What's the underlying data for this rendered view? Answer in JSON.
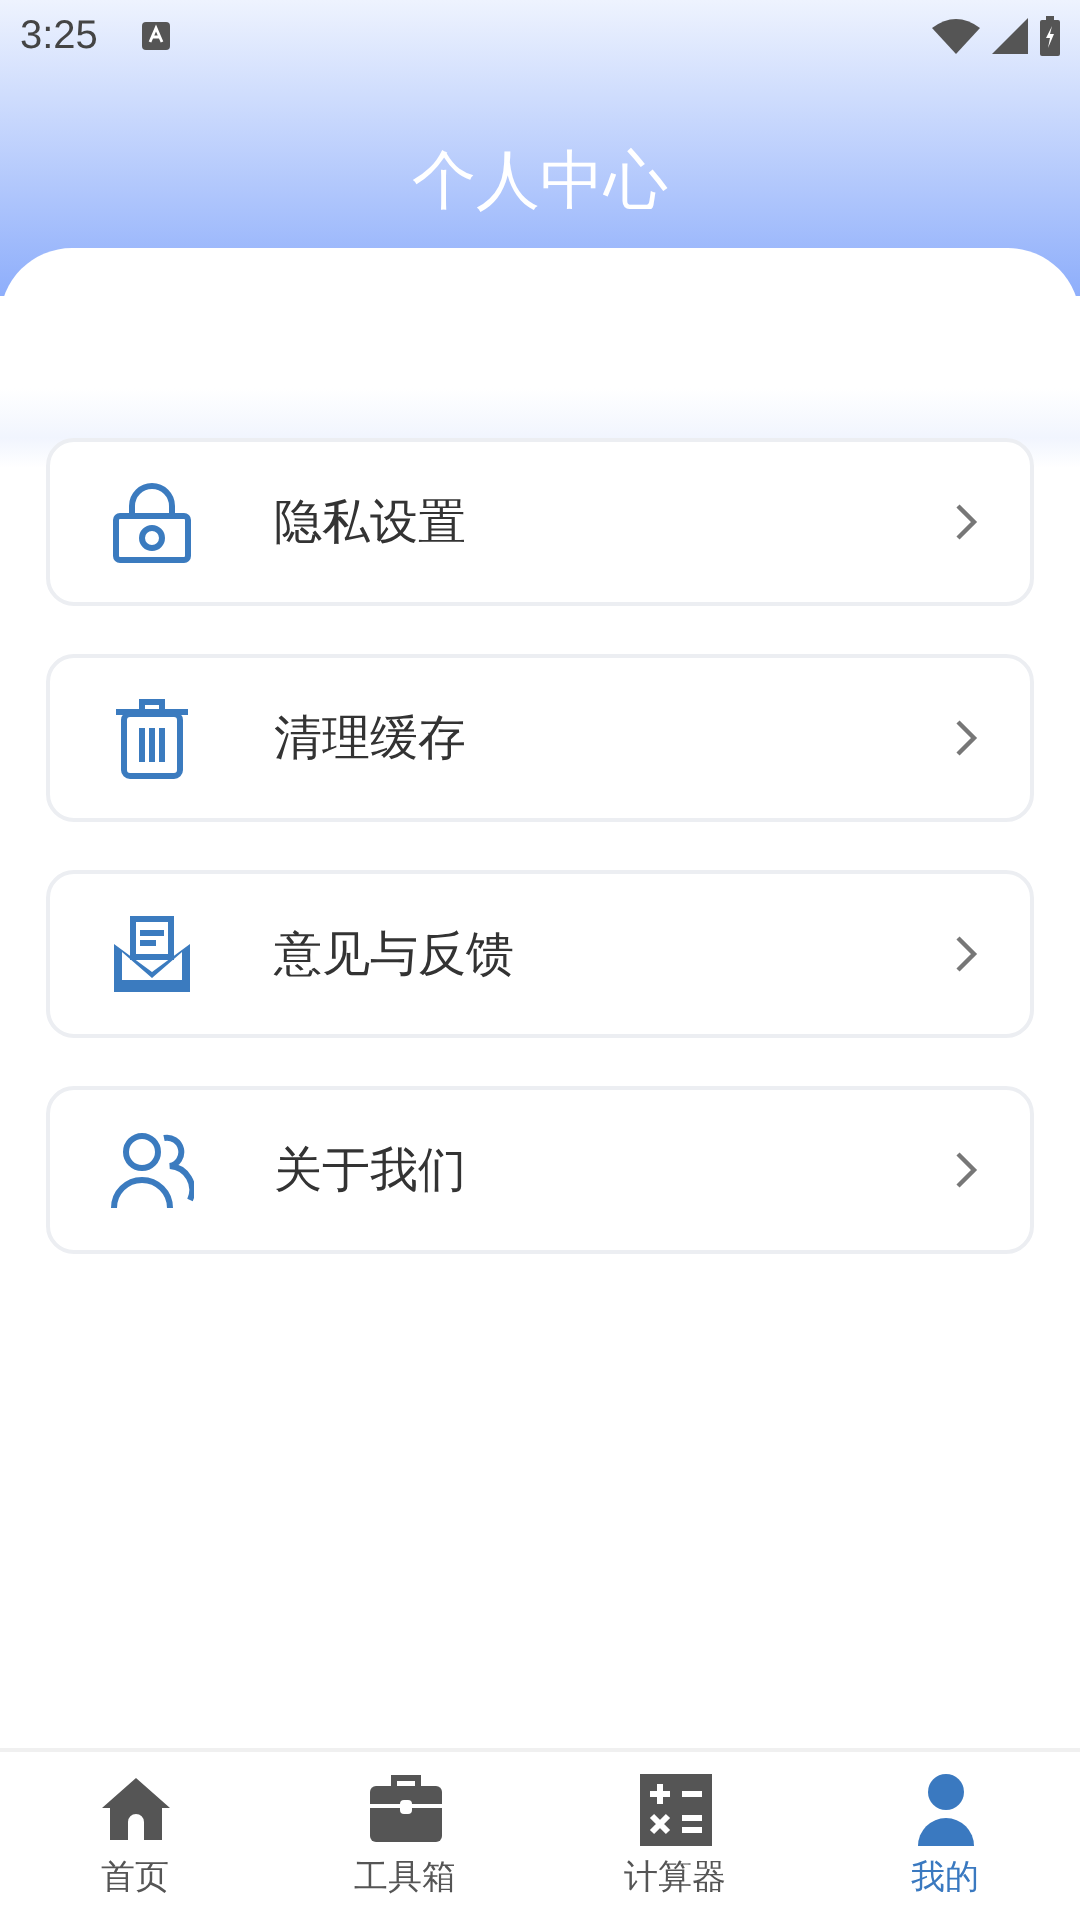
{
  "status_bar": {
    "time": "3:25"
  },
  "header": {
    "title": "个人中心"
  },
  "menu": [
    {
      "kind": "privacy",
      "label": "隐私设置"
    },
    {
      "kind": "trash",
      "label": "清理缓存"
    },
    {
      "kind": "feedback",
      "label": "意见与反馈"
    },
    {
      "kind": "about",
      "label": "关于我们"
    }
  ],
  "tabs": [
    {
      "kind": "home",
      "label": "首页",
      "selected": false
    },
    {
      "kind": "toolbox",
      "label": "工具箱",
      "selected": false
    },
    {
      "kind": "calculator",
      "label": "计算器",
      "selected": false
    },
    {
      "kind": "profile",
      "label": "我的",
      "selected": true
    }
  ]
}
